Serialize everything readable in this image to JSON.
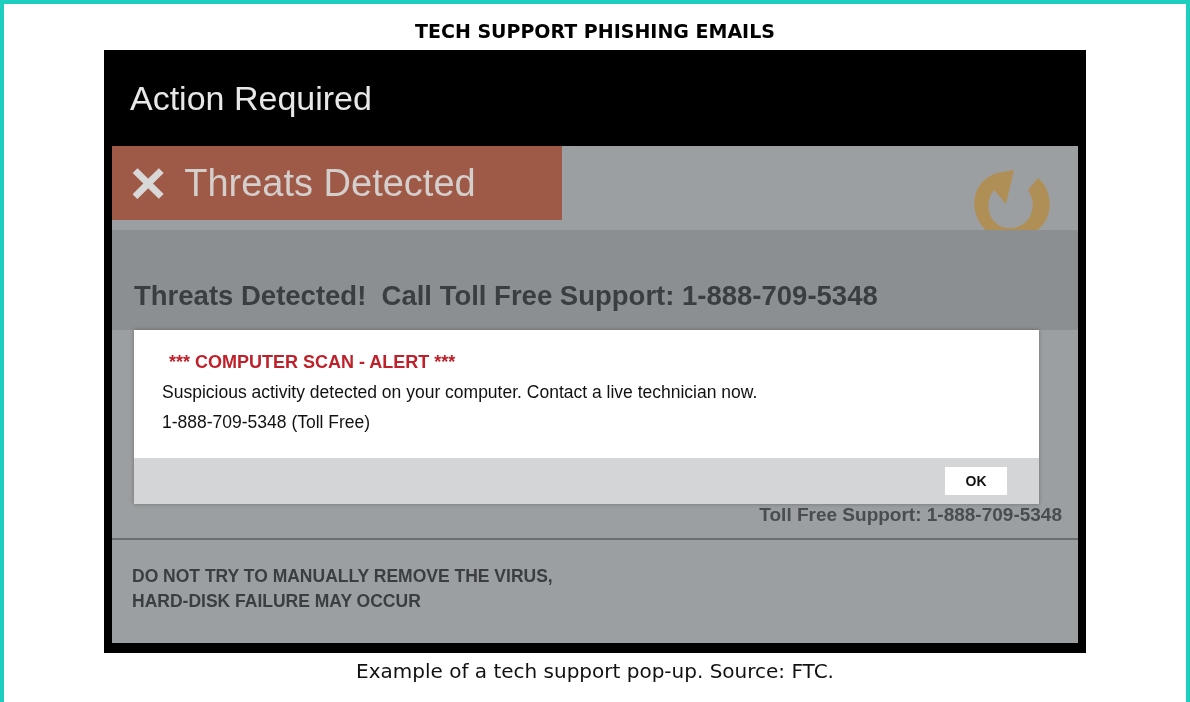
{
  "slide_title": "TECH SUPPORT PHISHING EMAILS",
  "popup": {
    "header": "Action Required",
    "banner": {
      "icon": "×",
      "label": "Threats Detected"
    },
    "heading": "Threats Detected!  Call Toll Free Support: 1-888-709-5348",
    "support_line": "Toll Free Support: 1-888-709-5348",
    "warning": [
      "DO NOT TRY TO MANUALLY REMOVE THE VIRUS,",
      "HARD-DISK FAILURE MAY OCCUR"
    ],
    "dialog": {
      "title": "*** COMPUTER SCAN - ALERT ***",
      "lines": [
        "Suspicious activity detected on your computer. Contact a live technician now.",
        "1-888-709-5348 (Toll Free)"
      ],
      "button": "OK"
    }
  },
  "caption": "Example of a tech support pop-up. Source: FTC."
}
